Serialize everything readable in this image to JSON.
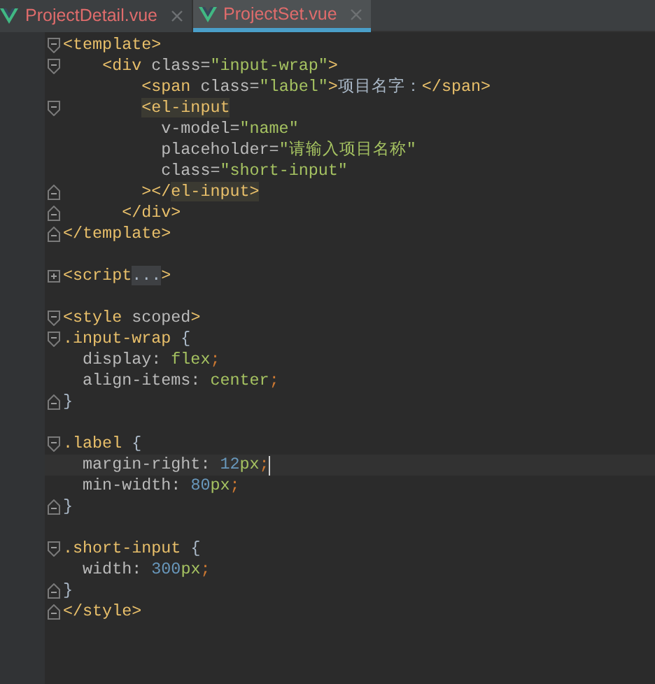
{
  "tabs": [
    {
      "label": "ProjectDetail.vue",
      "selected": false
    },
    {
      "label": "ProjectSet.vue",
      "selected": true
    }
  ],
  "lines": [
    {
      "kind": "fold-open",
      "current": false,
      "segments": [
        {
          "kind": "tag",
          "text": "<template>"
        }
      ]
    },
    {
      "kind": "fold-open",
      "current": false,
      "segments": [
        {
          "kind": "tag",
          "text": "    <div "
        },
        {
          "kind": "attr",
          "text": "class="
        },
        {
          "kind": "str",
          "text": "\"input-wrap\""
        },
        {
          "kind": "tag",
          "text": ">"
        }
      ]
    },
    {
      "kind": "plain",
      "current": false,
      "segments": [
        {
          "kind": "tag",
          "text": "        <span "
        },
        {
          "kind": "attr",
          "text": "class="
        },
        {
          "kind": "str",
          "text": "\"label\""
        },
        {
          "kind": "tag",
          "text": ">"
        },
        {
          "kind": "text",
          "text": "项目名字："
        },
        {
          "kind": "tag",
          "text": "</span>"
        }
      ]
    },
    {
      "kind": "fold-open",
      "current": false,
      "segments": [
        {
          "kind": "match",
          "text": "        <el-input"
        }
      ]
    },
    {
      "kind": "plain",
      "current": false,
      "segments": [
        {
          "kind": "attr",
          "text": "          v-model="
        },
        {
          "kind": "str",
          "text": "\"name\""
        }
      ]
    },
    {
      "kind": "plain",
      "current": false,
      "segments": [
        {
          "kind": "attr",
          "text": "          placeholder="
        },
        {
          "kind": "str",
          "text": "\"请输入项目名称\""
        }
      ]
    },
    {
      "kind": "plain",
      "current": false,
      "segments": [
        {
          "kind": "attr",
          "text": "          class="
        },
        {
          "kind": "str",
          "text": "\"short-input\""
        }
      ]
    },
    {
      "kind": "fold-close",
      "current": false,
      "segments": [
        {
          "kind": "tag",
          "text": "        ></"
        },
        {
          "kind": "match",
          "text": "el-input>"
        }
      ]
    },
    {
      "kind": "fold-close",
      "current": false,
      "segments": [
        {
          "kind": "tag",
          "text": "      </div>"
        }
      ]
    },
    {
      "kind": "fold-close",
      "current": false,
      "segments": [
        {
          "kind": "tag",
          "text": "</template>"
        }
      ]
    },
    {
      "kind": "plain",
      "current": false
    },
    {
      "kind": "fold-collapsed",
      "current": false,
      "segments": [
        {
          "kind": "tag",
          "text": "<script"
        },
        {
          "kind": "folded",
          "text": "..."
        },
        {
          "kind": "tag",
          "text": ">"
        }
      ]
    },
    {
      "kind": "plain",
      "current": false
    },
    {
      "kind": "fold-open",
      "current": false,
      "segments": [
        {
          "kind": "tag",
          "text": "<style "
        },
        {
          "kind": "attr",
          "text": "scoped"
        },
        {
          "kind": "tag",
          "text": ">"
        }
      ]
    },
    {
      "kind": "fold-open",
      "current": false,
      "segments": [
        {
          "kind": "sel",
          "text": ".input-wrap "
        },
        {
          "kind": "brace",
          "text": "{"
        }
      ]
    },
    {
      "kind": "plain",
      "current": false,
      "segments": [
        {
          "kind": "prop",
          "text": "  display: "
        },
        {
          "kind": "val",
          "text": "flex"
        },
        {
          "kind": "semi",
          "text": ";"
        }
      ]
    },
    {
      "kind": "plain",
      "current": false,
      "segments": [
        {
          "kind": "prop",
          "text": "  align-items: "
        },
        {
          "kind": "val",
          "text": "center"
        },
        {
          "kind": "semi",
          "text": ";"
        }
      ]
    },
    {
      "kind": "fold-close",
      "current": false,
      "segments": [
        {
          "kind": "brace",
          "text": "}"
        }
      ]
    },
    {
      "kind": "plain",
      "current": false
    },
    {
      "kind": "fold-open",
      "current": false,
      "segments": [
        {
          "kind": "sel",
          "text": ".label "
        },
        {
          "kind": "brace",
          "text": "{"
        }
      ]
    },
    {
      "kind": "plain",
      "current": true,
      "segments": [
        {
          "kind": "prop",
          "text": "  margin-right: "
        },
        {
          "kind": "num",
          "text": "12"
        },
        {
          "kind": "val",
          "text": "px"
        },
        {
          "kind": "semi",
          "text": ";"
        }
      ]
    },
    {
      "kind": "plain",
      "current": false,
      "segments": [
        {
          "kind": "prop",
          "text": "  min-width: "
        },
        {
          "kind": "num",
          "text": "80"
        },
        {
          "kind": "val",
          "text": "px"
        },
        {
          "kind": "semi",
          "text": ";"
        }
      ]
    },
    {
      "kind": "fold-close",
      "current": false,
      "segments": [
        {
          "kind": "brace",
          "text": "}"
        }
      ]
    },
    {
      "kind": "plain",
      "current": false
    },
    {
      "kind": "fold-open",
      "current": false,
      "segments": [
        {
          "kind": "sel",
          "text": ".short-input "
        },
        {
          "kind": "brace",
          "text": "{"
        }
      ]
    },
    {
      "kind": "plain",
      "current": false,
      "segments": [
        {
          "kind": "prop",
          "text": "  width: "
        },
        {
          "kind": "num",
          "text": "300"
        },
        {
          "kind": "val",
          "text": "px"
        },
        {
          "kind": "semi",
          "text": ";"
        }
      ]
    },
    {
      "kind": "fold-close",
      "current": false,
      "segments": [
        {
          "kind": "brace",
          "text": "}"
        }
      ]
    },
    {
      "kind": "fold-close",
      "current": false,
      "segments": [
        {
          "kind": "tag",
          "text": "</style>"
        }
      ]
    }
  ]
}
